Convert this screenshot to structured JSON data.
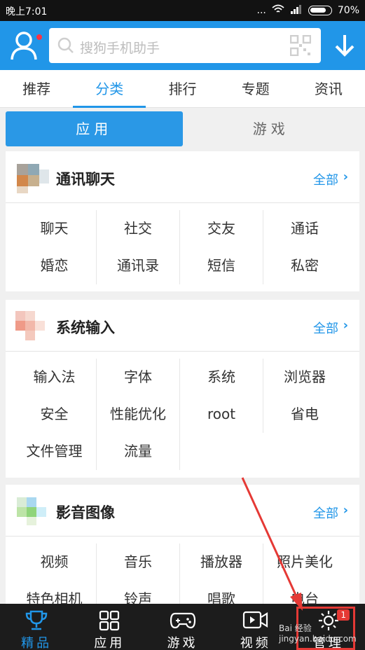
{
  "status_bar": {
    "time": "晚上7:01",
    "signal_dots": "...",
    "battery": "70%"
  },
  "header": {
    "search_placeholder": "搜狗手机助手"
  },
  "tabs": [
    {
      "label": "推荐"
    },
    {
      "label": "分类"
    },
    {
      "label": "排行"
    },
    {
      "label": "专题"
    },
    {
      "label": "资讯"
    }
  ],
  "segment": {
    "apps": "应用",
    "games": "游戏"
  },
  "cards": [
    {
      "title": "通讯聊天",
      "more": "全部",
      "rows": [
        [
          "聊天",
          "社交",
          "交友",
          "通话"
        ],
        [
          "婚恋",
          "通讯录",
          "短信",
          "私密"
        ]
      ]
    },
    {
      "title": "系统输入",
      "more": "全部",
      "rows": [
        [
          "输入法",
          "字体",
          "系统",
          "浏览器"
        ],
        [
          "安全",
          "性能优化",
          "root",
          "省电"
        ],
        [
          "文件管理",
          "流量",
          "",
          ""
        ]
      ]
    },
    {
      "title": "影音图像",
      "more": "全部",
      "rows": [
        [
          "视频",
          "音乐",
          "播放器",
          "照片美化"
        ],
        [
          "特色相机",
          "铃声",
          "唱歌",
          "电台"
        ]
      ]
    }
  ],
  "bottom_nav": [
    {
      "label": "精品",
      "icon": "trophy-icon"
    },
    {
      "label": "应用",
      "icon": "apps-grid-icon"
    },
    {
      "label": "游戏",
      "icon": "gamepad-icon"
    },
    {
      "label": "视频",
      "icon": "video-icon"
    },
    {
      "label": "管理",
      "icon": "manage-gear-icon",
      "badge": "1"
    }
  ],
  "watermark": "Bai 经验\njingyan.baidu.com",
  "colors": {
    "primary": "#2196e8",
    "highlight": "#e53935"
  }
}
